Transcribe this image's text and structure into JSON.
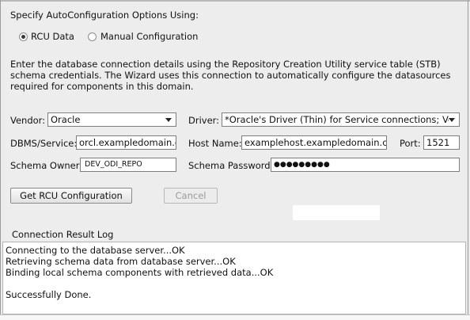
{
  "section": {
    "title": "Specify AutoConfiguration Options Using:"
  },
  "options": [
    {
      "label": "RCU Data",
      "checked": true
    },
    {
      "label": "Manual Configuration",
      "checked": false
    }
  ],
  "description": "Enter the database connection details using the Repository Creation Utility service table (STB) schema credentials. The Wizard uses this connection to automatically configure the datasources required for components in this domain.",
  "fields": {
    "vendor_label": "Vendor:",
    "vendor_value": "Oracle",
    "driver_label": "Driver:",
    "driver_value": "*Oracle's Driver (Thin) for Service connections; Ver...",
    "dbms_label": "DBMS/Service:",
    "dbms_value": "orcl.exampledomain.com",
    "host_label": "Host Name:",
    "host_value": "examplehost.exampledomain.com",
    "port_label": "Port:",
    "port_value": "1521",
    "schema_owner_label": "Schema Owner:",
    "schema_owner_value": "DEV_ODI_REPO",
    "schema_password_label": "Schema Password:",
    "schema_password_value": "●●●●●●●●●"
  },
  "buttons": {
    "get_rcu": "Get RCU Configuration",
    "cancel": "Cancel"
  },
  "log": {
    "title": "Connection Result Log",
    "lines": [
      "Connecting to the database server...OK",
      "Retrieving schema data from database server...OK",
      "Binding local schema components with retrieved data...OK",
      "",
      "Successfully Done."
    ]
  }
}
